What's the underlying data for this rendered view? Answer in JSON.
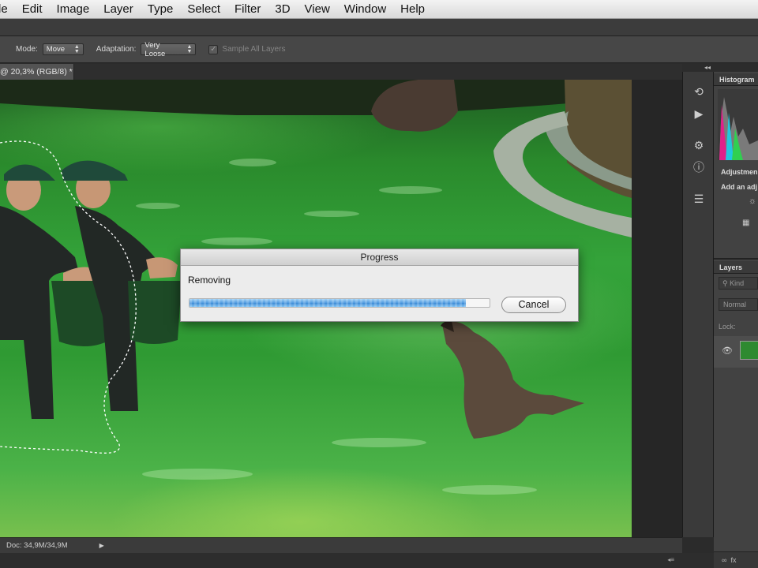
{
  "menubar": {
    "items": [
      "le",
      "Edit",
      "Image",
      "Layer",
      "Type",
      "Select",
      "Filter",
      "3D",
      "View",
      "Window",
      "Help"
    ]
  },
  "options": {
    "mode_label": "Mode:",
    "mode_value": "Move",
    "adaptation_label": "Adaptation:",
    "adaptation_value": "Very Loose",
    "sample_all_layers_label": "Sample All Layers",
    "sample_all_layers_checked": true
  },
  "document": {
    "tab_label": "@ 20,3% (RGB/8) *"
  },
  "panels": {
    "histogram_label": "Histogram",
    "adjustments_label": "Adjustmen",
    "add_adjustment_label": "Add an adj",
    "layers_tab_label": "Layers",
    "kind_placeholder": "Kind",
    "blend_mode": "Normal",
    "lock_label": "Lock:"
  },
  "status": {
    "doc_size": "Doc: 34,9M/34,9M"
  },
  "dialog": {
    "title": "Progress",
    "status_text": "Removing",
    "progress": 0.92,
    "cancel_label": "Cancel"
  },
  "colors": {
    "accent_progress": "#4f9ae0",
    "water_green": "#2f9a33"
  }
}
